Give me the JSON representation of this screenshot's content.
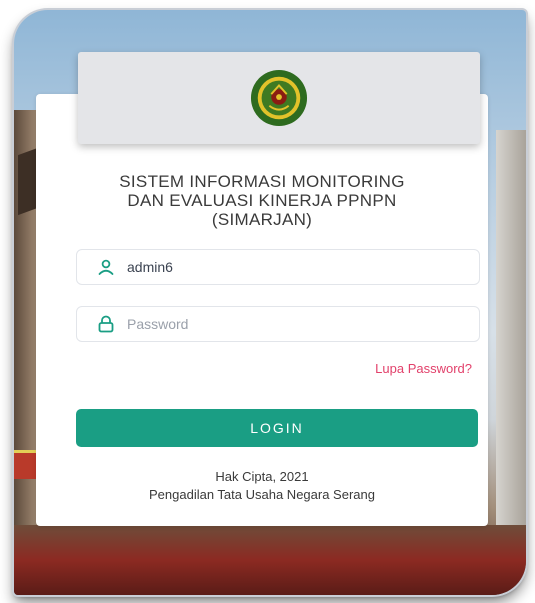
{
  "logo": {
    "icon": "court-emblem-icon",
    "colors": {
      "ring": "#2e6b1f",
      "gold": "#e2c22a",
      "center": "#8a1c12"
    }
  },
  "title": {
    "line1": "SISTEM INFORMASI MONITORING",
    "line2": "DAN EVALUASI KINERJA PPNPN",
    "line3": "(SIMARJAN)"
  },
  "form": {
    "username": {
      "value": "admin6",
      "icon": "user-icon"
    },
    "password": {
      "value": "",
      "placeholder": "Password",
      "icon": "lock-icon"
    },
    "forgot_label": "Lupa Password?",
    "login_label": "LOGIN"
  },
  "footer": {
    "line1": "Hak Cipta, 2021",
    "line2": "Pengadilan Tata Usaha Negara Serang"
  },
  "colors": {
    "accent": "#1a9e84",
    "link": "#e2416b"
  }
}
